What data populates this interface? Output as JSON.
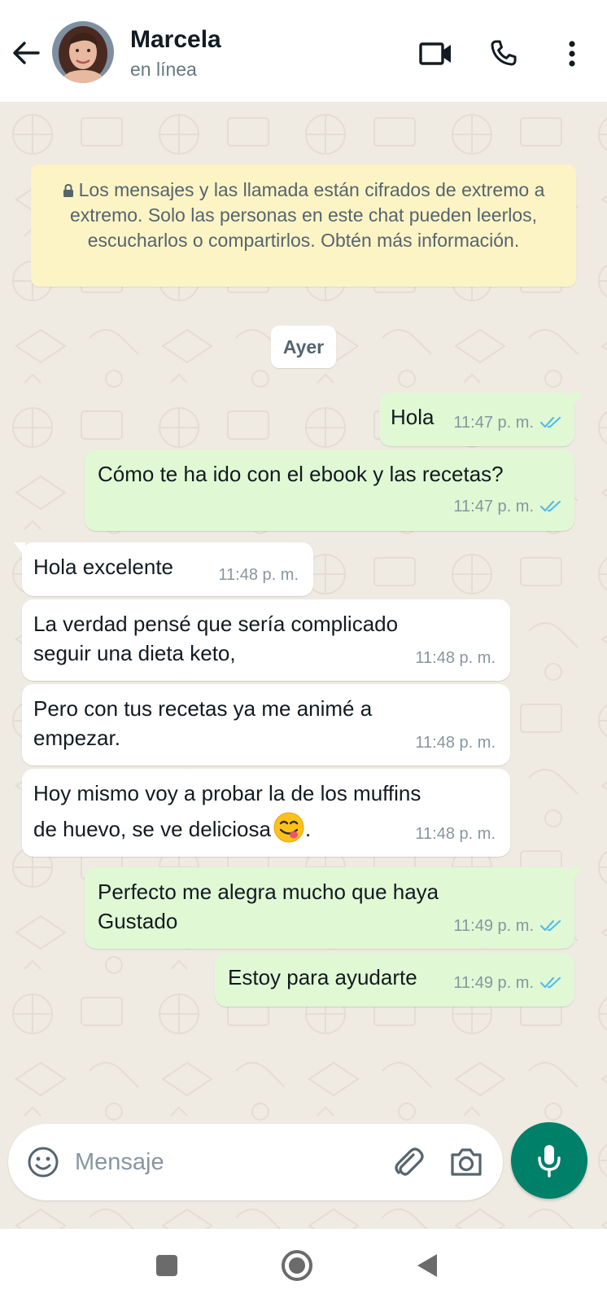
{
  "header": {
    "contact_name": "Marcela",
    "status": "en línea",
    "icons": [
      "back-arrow-icon",
      "video-camera-icon",
      "phone-icon",
      "more-vert-icon"
    ]
  },
  "chat": {
    "encryption_notice": "Los mensajes y las llamada están cifrados de extremo a extremo. Solo las personas en este chat pueden leerlos, escucharlos o compartirlos. Obtén más información.",
    "date_chip": "Ayer",
    "messages": [
      {
        "direction": "out",
        "lines": [
          "Hola"
        ],
        "time": "11:47 p. m.",
        "read": true
      },
      {
        "direction": "out",
        "lines": [
          "Cómo te ha ido con el ebook y las recetas?"
        ],
        "time": "11:47 p. m.",
        "read": true
      },
      {
        "direction": "in",
        "lines": [
          "Hola excelente"
        ],
        "time": "11:48 p. m."
      },
      {
        "direction": "in",
        "lines": [
          "La verdad pensé que sería complicado",
          "seguir una dieta keto,"
        ],
        "time": "11:48 p. m."
      },
      {
        "direction": "in",
        "lines": [
          "Pero con tus recetas ya me animé a",
          "empezar."
        ],
        "time": "11:48 p. m."
      },
      {
        "direction": "in",
        "lines": [
          "Hoy mismo voy a probar la de los muffins",
          "de huevo, se ve deliciosa",
          "."
        ],
        "time": "11:48 p. m.",
        "emoji": "face-savoring-food-emoji"
      },
      {
        "direction": "out",
        "lines": [
          "Perfecto me alegra mucho que haya",
          "Gustado"
        ],
        "time": "11:49 p. m.",
        "read": true
      },
      {
        "direction": "out",
        "lines": [
          "Estoy para ayudarte"
        ],
        "time": "11:49 p. m.",
        "read": true
      }
    ]
  },
  "composer": {
    "placeholder": "Mensaje",
    "icons": [
      "emoji-icon",
      "attach-icon",
      "camera-icon",
      "mic-icon"
    ]
  },
  "colors": {
    "accent": "#008069",
    "outgoing_bubble": "#e1f8d4",
    "incoming_bubble": "#ffffff",
    "chat_background": "#efeae2",
    "notice_background": "#fdf4c5",
    "read_ticks": "#53bdeb"
  }
}
